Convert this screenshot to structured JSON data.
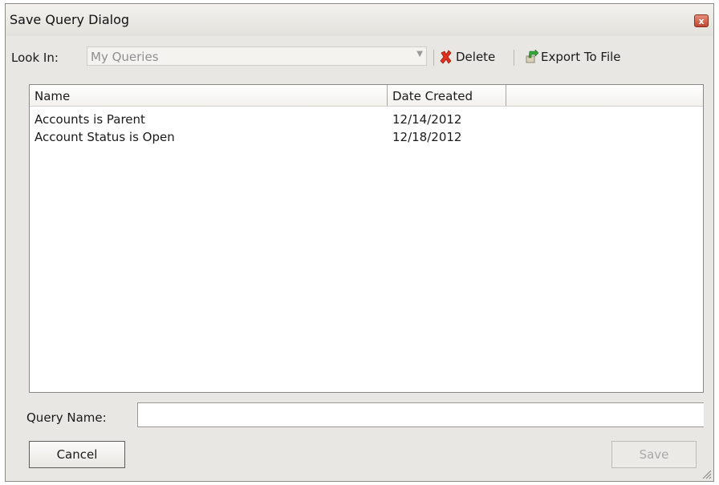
{
  "window": {
    "title": "Save Query Dialog",
    "close_glyph": "x"
  },
  "toolbar": {
    "look_in_label": "Look In:",
    "look_in_value": "My Queries",
    "delete_label": "Delete",
    "export_label": "Export To File",
    "icons": {
      "delete": "red-x-icon",
      "export": "export-arrow-icon"
    }
  },
  "list": {
    "columns": [
      "Name",
      "Date Created",
      ""
    ],
    "rows": [
      {
        "name": "Accounts is Parent",
        "date": "12/14/2012"
      },
      {
        "name": "Account Status is Open",
        "date": "12/18/2012"
      }
    ]
  },
  "form": {
    "query_name_label": "Query Name:",
    "query_name_value": ""
  },
  "buttons": {
    "cancel": "Cancel",
    "save": "Save"
  }
}
